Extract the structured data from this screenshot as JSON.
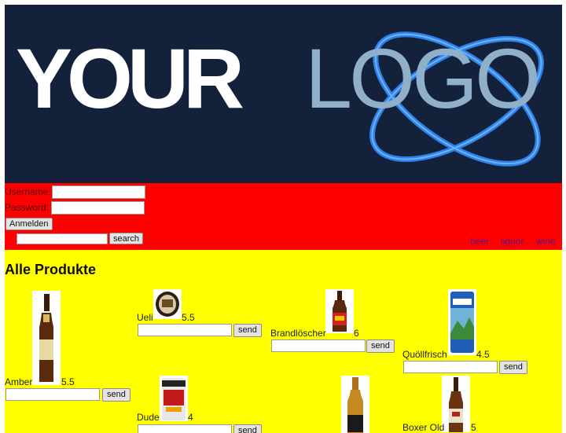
{
  "logo": {
    "text_bold": "YOUR",
    "text_light": "LOGO"
  },
  "login": {
    "username_label": "Username:",
    "password_label": "Password:",
    "username_value": "",
    "password_value": "",
    "submit_label": "Anmelden"
  },
  "search": {
    "value": "",
    "button_label": "search"
  },
  "categories": [
    "beer",
    "liquor",
    "wine"
  ],
  "products": {
    "heading": "Alle Produkte",
    "send_label": "send",
    "items": [
      {
        "name": "Amber",
        "price": "5.5",
        "bottle": "brown-bottle"
      },
      {
        "name": "Ueli",
        "price": "5.5",
        "bottle": "can-round"
      },
      {
        "name": "Brandlöscher",
        "price": "6",
        "bottle": "red-label-bottle"
      },
      {
        "name": "Quöllfrisch",
        "price": "4.5",
        "bottle": "blue-can"
      },
      {
        "name": "Dude",
        "price": "4",
        "bottle": "red-can"
      },
      {
        "name": "",
        "price": "",
        "bottle": "amber-bottle"
      },
      {
        "name": "Boxer Old",
        "price": "5",
        "bottle": "brown-bottle-2"
      }
    ]
  }
}
